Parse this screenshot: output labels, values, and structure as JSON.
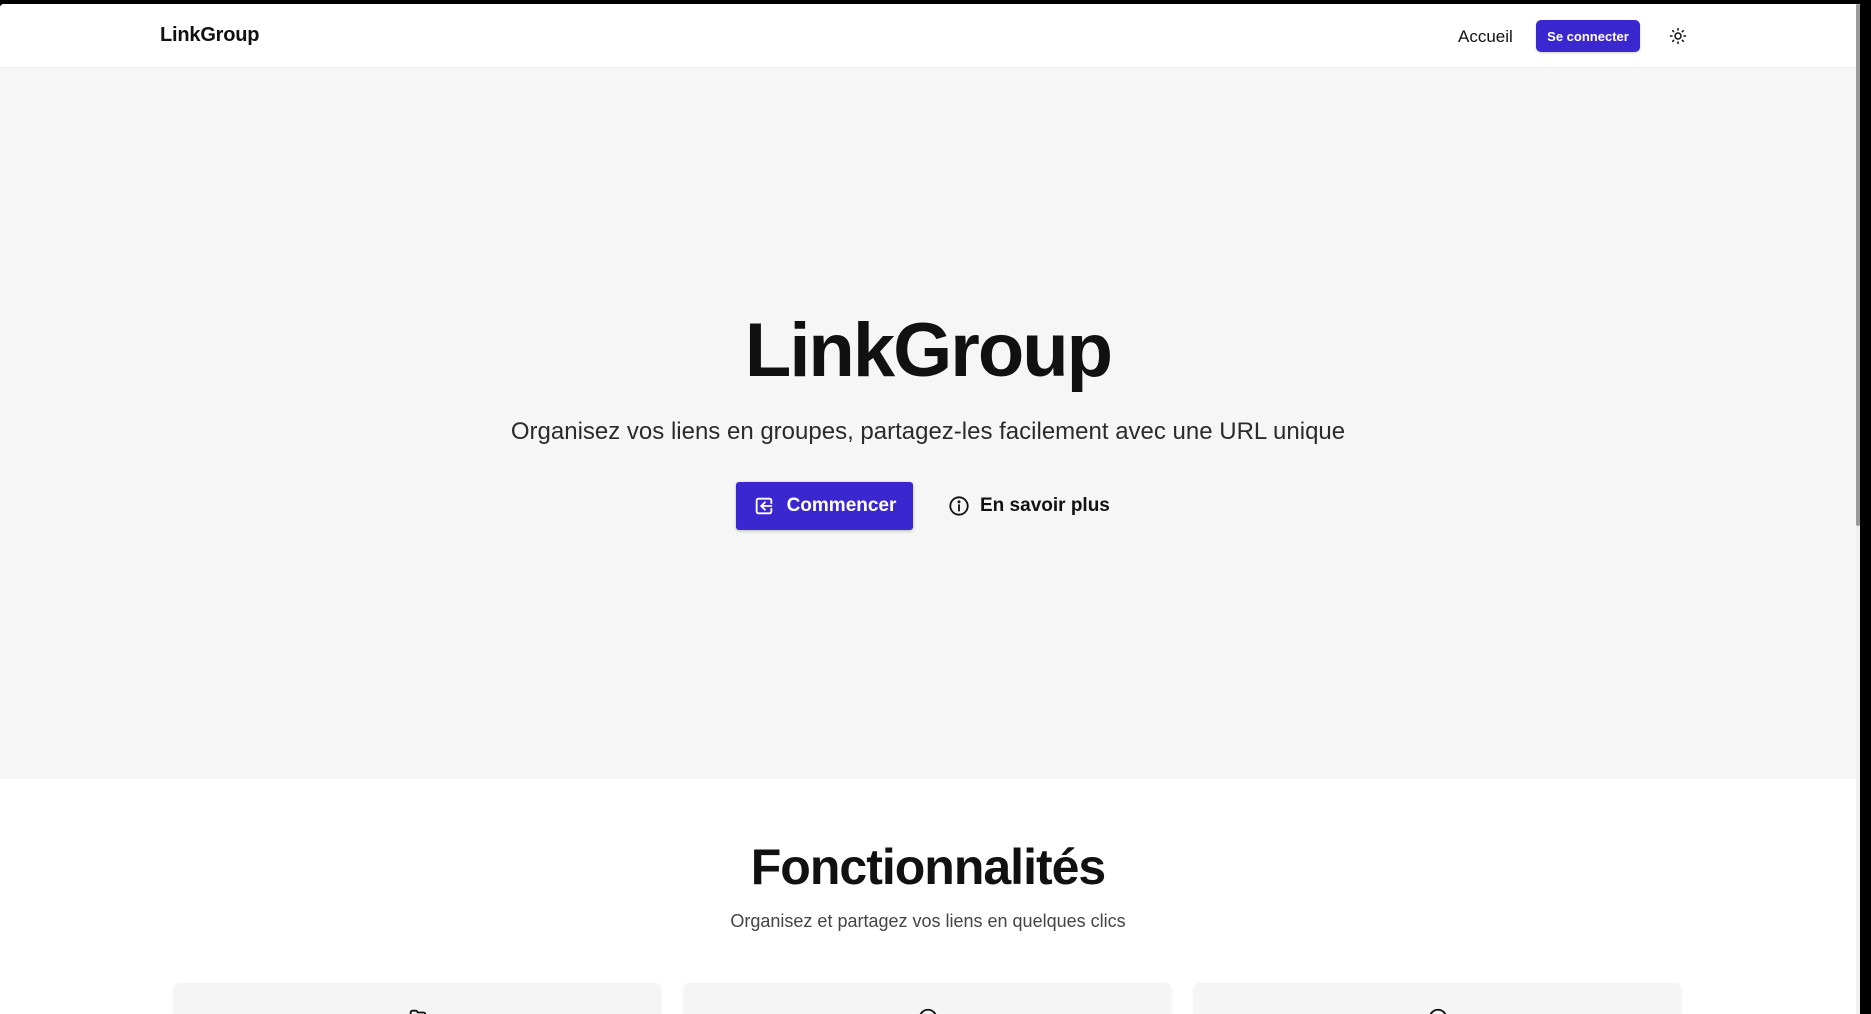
{
  "header": {
    "brand": "LinkGroup",
    "nav_home": "Accueil",
    "login_label": "Se connecter",
    "theme_icon": "sun-icon"
  },
  "hero": {
    "title": "LinkGroup",
    "subtitle": "Organisez vos liens en groupes, partagez-les facilement avec une URL unique",
    "start_label": "Commencer",
    "start_icon": "login-icon",
    "learn_label": "En savoir plus",
    "learn_icon": "info-icon"
  },
  "features": {
    "title": "Fonctionnalités",
    "subtitle": "Organisez et partagez vos liens en quelques clics",
    "cards": [
      {
        "icon": "folder-icon"
      },
      {
        "icon": "link-icon"
      },
      {
        "icon": "share-icon"
      }
    ]
  },
  "colors": {
    "accent": "#3b27cf",
    "hero_bg": "#f6f6f6",
    "text": "#111111"
  }
}
